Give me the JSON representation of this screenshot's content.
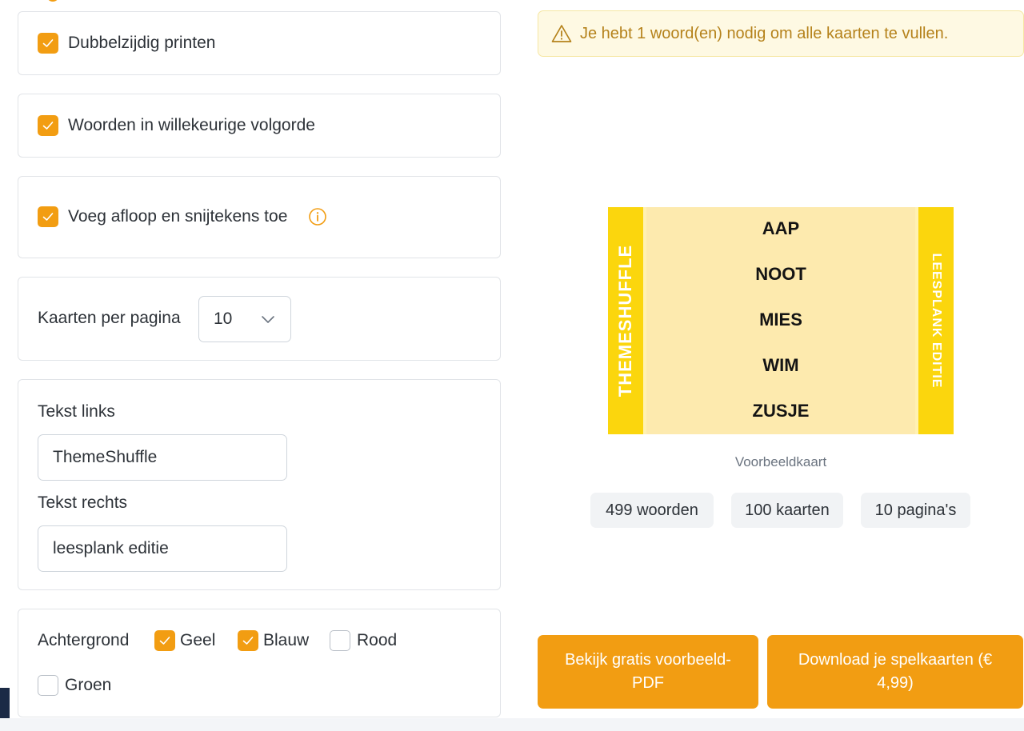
{
  "options": {
    "double_sided": {
      "label": "Dubbelzijdig printen",
      "checked": true
    },
    "random_order": {
      "label": "Woorden in willekeurige volgorde",
      "checked": true
    },
    "bleed": {
      "label": "Voeg afloop en snijtekens toe",
      "checked": true,
      "info_icon": "info-icon"
    }
  },
  "cards_per_page": {
    "label": "Kaarten per pagina",
    "value": "10"
  },
  "text_fields": {
    "left_label": "Tekst links",
    "left_value": "ThemeShuffle",
    "right_label": "Tekst rechts",
    "right_value": "leesplank editie"
  },
  "background": {
    "label": "Achtergrond",
    "options": [
      {
        "label": "Geel",
        "checked": true
      },
      {
        "label": "Blauw",
        "checked": true
      },
      {
        "label": "Rood",
        "checked": false
      },
      {
        "label": "Groen",
        "checked": false
      }
    ]
  },
  "warning": {
    "icon": "warning-icon",
    "text": "Je hebt 1 woord(en) nodig om alle kaarten te vullen."
  },
  "preview": {
    "left_text": "ThemeShuffle",
    "right_text": "leesplank editie",
    "words": [
      "AAP",
      "NOOT",
      "MIES",
      "WIM",
      "ZUSJE"
    ],
    "caption": "Voorbeeldkaart"
  },
  "stats": {
    "words": "499 woorden",
    "cards": "100 kaarten",
    "pages": "10 pagina's"
  },
  "buttons": {
    "preview_pdf": "Bekijk gratis voorbeeld-PDF",
    "download": "Download je spelkaarten (€ 4,99)"
  },
  "colors": {
    "accent": "#f29d12",
    "card_side": "#fbd60d",
    "card_body": "#fdeaae",
    "warning_bg": "#fef9e3",
    "warning_text": "#b5821b"
  }
}
